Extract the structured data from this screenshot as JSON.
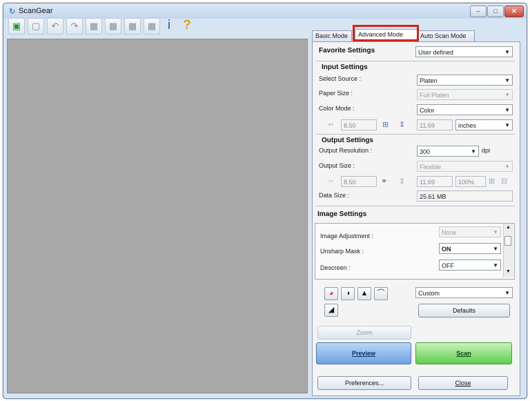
{
  "window": {
    "title": "ScanGear",
    "app_icon": "scanner-logo-icon",
    "min_glyph": "–",
    "max_glyph": "□",
    "close_glyph": "✕"
  },
  "toolbar": {
    "icons": [
      "scan-to-pc-icon",
      "crop-icon",
      "rotate-left-icon",
      "rotate-right-icon",
      "auto-crop-icon",
      "multi-crop-icon",
      "frame-icon",
      "frame-select-icon",
      "info-icon",
      "help-icon"
    ],
    "info_glyph": "i",
    "help_glyph": "?"
  },
  "tabs": [
    {
      "label": "Basic Mode",
      "active": false
    },
    {
      "label": "Advanced Mode",
      "active": true
    },
    {
      "label": "Auto Scan Mode",
      "active": false
    }
  ],
  "favorite": {
    "label": "Favorite Settings",
    "value": "User defined"
  },
  "input": {
    "heading": "Input Settings",
    "source_label": "Select Source :",
    "source_value": "Platen",
    "paper_label": "Paper Size :",
    "paper_value": "Full Platen",
    "color_label": "Color Mode :",
    "color_value": "Color",
    "width": "8.50",
    "height": "11.69",
    "unit": "inches"
  },
  "output": {
    "heading": "Output Settings",
    "resolution_label": "Output Resolution :",
    "resolution_value": "300",
    "resolution_unit": "dpi",
    "size_label": "Output Size :",
    "size_value": "Flexible",
    "width": "8.50",
    "height": "11.69",
    "scale": "100%",
    "data_label": "Data Size :",
    "data_value": "25.61 MB"
  },
  "image": {
    "heading": "Image Settings",
    "rows": [
      {
        "label": "Image Adjustment :",
        "value": "None",
        "disabled": true
      },
      {
        "label": "Unsharp Mask :",
        "value": "ON",
        "disabled": false
      },
      {
        "label": "Descreen :",
        "value": "OFF",
        "disabled": false
      }
    ]
  },
  "adjust": {
    "icons": [
      "color-adjust-icon",
      "brightness-contrast-icon",
      "histogram-icon",
      "tone-curve-icon",
      "final-review-icon"
    ],
    "preset_value": "Custom",
    "defaults_label": "Defaults"
  },
  "buttons": {
    "zoom": "Zoom",
    "preview": "Preview",
    "scan": "Scan",
    "preferences": "Preferences...",
    "close": "Close"
  },
  "colors": {
    "highlight": "#d8211b",
    "preview_area": "#a8a8a8",
    "scan_green": "#5fcd51",
    "preview_blue": "#6ea2e0"
  }
}
